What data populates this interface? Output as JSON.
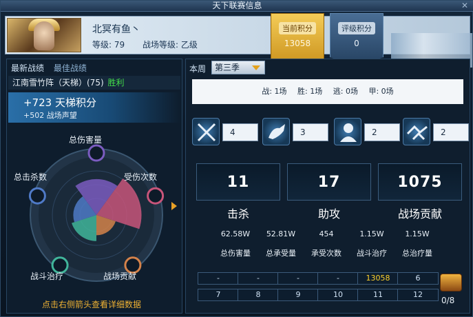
{
  "window": {
    "title": "天下联赛信息"
  },
  "player": {
    "name": "北冥有鱼丶",
    "level_label": "等级: 79",
    "bf_level_label": "战场等级: 乙级"
  },
  "scores": {
    "current": {
      "label": "当前积分",
      "value": "13058"
    },
    "rating": {
      "label": "评级积分",
      "value": "0"
    }
  },
  "left_tabs": {
    "latest": "最新战绩",
    "best": "最佳战绩"
  },
  "match": {
    "name": "江南雪竹阵（天梯）(75)",
    "result": "胜利"
  },
  "reward": {
    "ladder": "+723 天梯积分",
    "prestige": "+502 战场声望"
  },
  "radar": {
    "labels": [
      "总伤害量",
      "受伤次数",
      "战场贡献",
      "战斗治疗",
      "总击杀数"
    ],
    "values": [
      0.62,
      0.78,
      0.35,
      0.45,
      0.4
    ],
    "colors": [
      "#7b5cc0",
      "#c8557a",
      "#d4824a",
      "#41b59a",
      "#4f7ac7"
    ]
  },
  "hint": "点击右侧箭头查看详细数据",
  "season": {
    "week_label": "本周",
    "selected": "第三季"
  },
  "record": {
    "battles": "战: 1场",
    "wins": "胜: 1场",
    "escapes": "逃: 0场",
    "armor": "甲: 0场"
  },
  "stat_icons": [
    {
      "icon": "crossed-swords-icon",
      "value": "4"
    },
    {
      "icon": "leaping-horse-icon",
      "value": "3"
    },
    {
      "icon": "warrior-portrait-icon",
      "value": "2"
    },
    {
      "icon": "handshake-icon",
      "value": "2"
    }
  ],
  "big_stats": [
    {
      "value": "11",
      "label": "击杀"
    },
    {
      "value": "17",
      "label": "助攻"
    },
    {
      "value": "1075",
      "label": "战场贡献"
    }
  ],
  "details": [
    {
      "value": "62.58W",
      "label": "总伤害量"
    },
    {
      "value": "52.81W",
      "label": "总承受量"
    },
    {
      "value": "454",
      "label": "承受次数"
    },
    {
      "value": "1.15W",
      "label": "战斗治疗"
    },
    {
      "value": "1.15W",
      "label": "总治疗量"
    }
  ],
  "slots": [
    "-",
    "-",
    "-",
    "-",
    "13058",
    "6",
    "7",
    "8",
    "9",
    "10",
    "11",
    "12"
  ],
  "chest": {
    "count": "0/8"
  }
}
